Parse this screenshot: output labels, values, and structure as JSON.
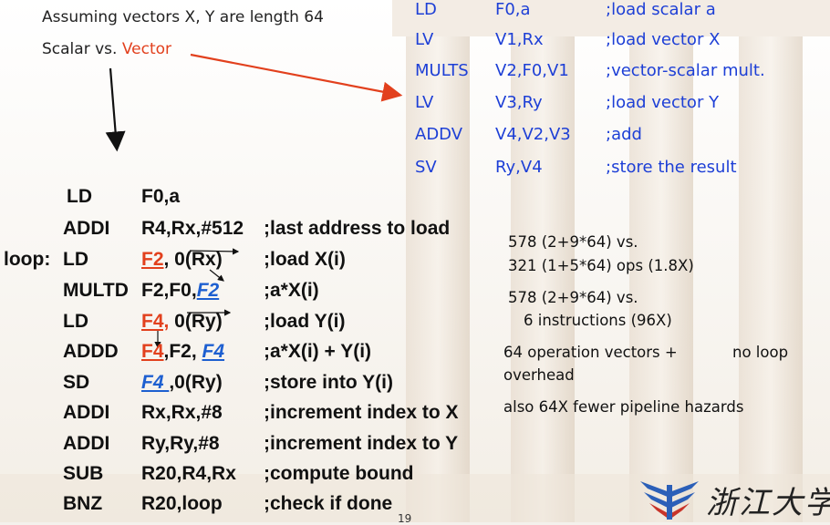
{
  "intro": {
    "line1": "Assuming vectors X, Y are length 64",
    "scalar_label": "Scalar vs. ",
    "vector_label": "Vector"
  },
  "vector_code": [
    {
      "op": "LD",
      "args": "F0,a",
      "comment": ";load scalar a"
    },
    {
      "op": "LV",
      "args": "V1,Rx",
      "comment": ";load vector X"
    },
    {
      "op": "MULTS",
      "args": "V2,F0,V1",
      "comment": ";vector-scalar mult."
    },
    {
      "op": "LV",
      "args": "V3,Ry",
      "comment": ";load vector Y"
    },
    {
      "op": "ADDV",
      "args": "V4,V2,V3",
      "comment": ";add"
    },
    {
      "op": "SV",
      "args": "Ry,V4",
      "comment": ";store the result"
    }
  ],
  "scalar_code": {
    "r0": {
      "label": "",
      "op": "LD",
      "args": "F0,a",
      "comment": ""
    },
    "r1": {
      "label": "",
      "op": "ADDI",
      "args": "R4,Rx,#512",
      "comment": ";last address to load"
    },
    "r2": {
      "label": "loop:",
      "op": "LD",
      "a1": "F2",
      "a2": ", 0(Rx)",
      "comment": ";load X(i)"
    },
    "r3": {
      "label": "",
      "op": "MULTD",
      "a1": "F2,F0,",
      "a2": "F2",
      "comment": ";a*X(i)"
    },
    "r4": {
      "label": "",
      "op": "LD",
      "a1": "F4,",
      "a2": " 0(Ry)",
      "comment": ";load Y(i)"
    },
    "r5": {
      "label": "",
      "op": "ADDD",
      "a1": "F4",
      "a2": ",F2, ",
      "a3": "F4",
      "comment": ";a*X(i) + Y(i)"
    },
    "r6": {
      "label": "",
      "op": "SD",
      "a1": "F4 ",
      "a2": ",0(Ry)",
      "comment": ";store into Y(i)"
    },
    "r7": {
      "label": "",
      "op": "ADDI",
      "args": "Rx,Rx,#8",
      "comment": ";increment index to X"
    },
    "r8": {
      "label": "",
      "op": "ADDI",
      "args": "Ry,Ry,#8",
      "comment": ";increment index to Y"
    },
    "r9": {
      "label": "",
      "op": "SUB",
      "args": "R20,R4,Rx",
      "comment": ";compute bound"
    },
    "r10": {
      "label": "",
      "op": "BNZ",
      "args": "R20,loop",
      "comment": ";check if done"
    }
  },
  "notes": {
    "n1a": "578 (2+9*64) vs.",
    "n1b": "321 (1+5*64) ops (1.8X)",
    "n2a": "578 (2+9*64) vs.",
    "n2b": "6 instructions (96X)",
    "n3a": "64 operation vectors +",
    "n3b": "no loop",
    "n3c": "overhead",
    "n4": "also 64X fewer pipeline hazards"
  },
  "logo": {
    "text": "浙江大学"
  },
  "page_number": "19",
  "colors": {
    "red": "#e2401d",
    "vector_blue": "#1d3fd6",
    "italic_blue": "#1d5fd0"
  }
}
